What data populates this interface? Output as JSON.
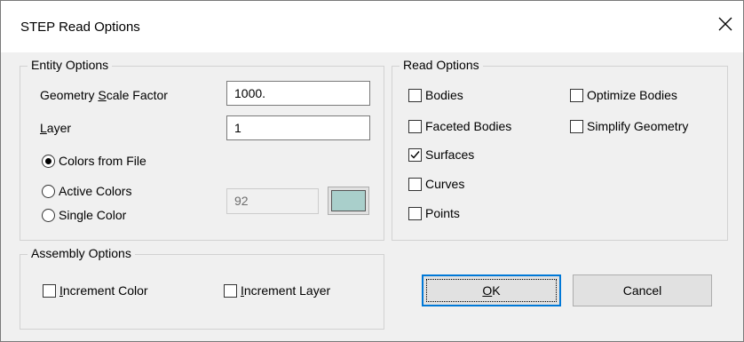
{
  "window": {
    "title": "STEP Read Options"
  },
  "entity_options": {
    "legend": "Entity Options",
    "scale_label_pre": "Geometry ",
    "scale_label_key": "S",
    "scale_label_post": "cale Factor",
    "scale_value": "1000.",
    "layer_label_key": "L",
    "layer_label_post": "ayer",
    "layer_value": "1",
    "radios": [
      {
        "label": "Colors from File",
        "checked": true
      },
      {
        "label": "Active Colors",
        "checked": false
      },
      {
        "label": "Single Color",
        "checked": false
      }
    ],
    "color_number": "92",
    "color_swatch": "#a9cfcb"
  },
  "read_options": {
    "legend": "Read Options",
    "left": [
      {
        "label": "Bodies",
        "checked": false
      },
      {
        "label": "Faceted Bodies",
        "checked": false
      },
      {
        "label": "Surfaces",
        "checked": true
      },
      {
        "label": "Curves",
        "checked": false
      },
      {
        "label": "Points",
        "checked": false
      }
    ],
    "right": [
      {
        "label": "Optimize Bodies",
        "checked": false
      },
      {
        "label": "Simplify Geometry",
        "checked": false
      }
    ]
  },
  "assembly_options": {
    "legend": "Assembly Options",
    "increment_color_key": "I",
    "increment_color_post": "ncrement Color",
    "increment_layer_key": "I",
    "increment_layer_post": "ncrement Layer"
  },
  "buttons": {
    "ok_key": "O",
    "ok_post": "K",
    "cancel": "Cancel"
  },
  "colors": {
    "accent": "#0078d7",
    "window_bg": "#f0f0f0",
    "titlebar_bg": "#ffffff"
  }
}
